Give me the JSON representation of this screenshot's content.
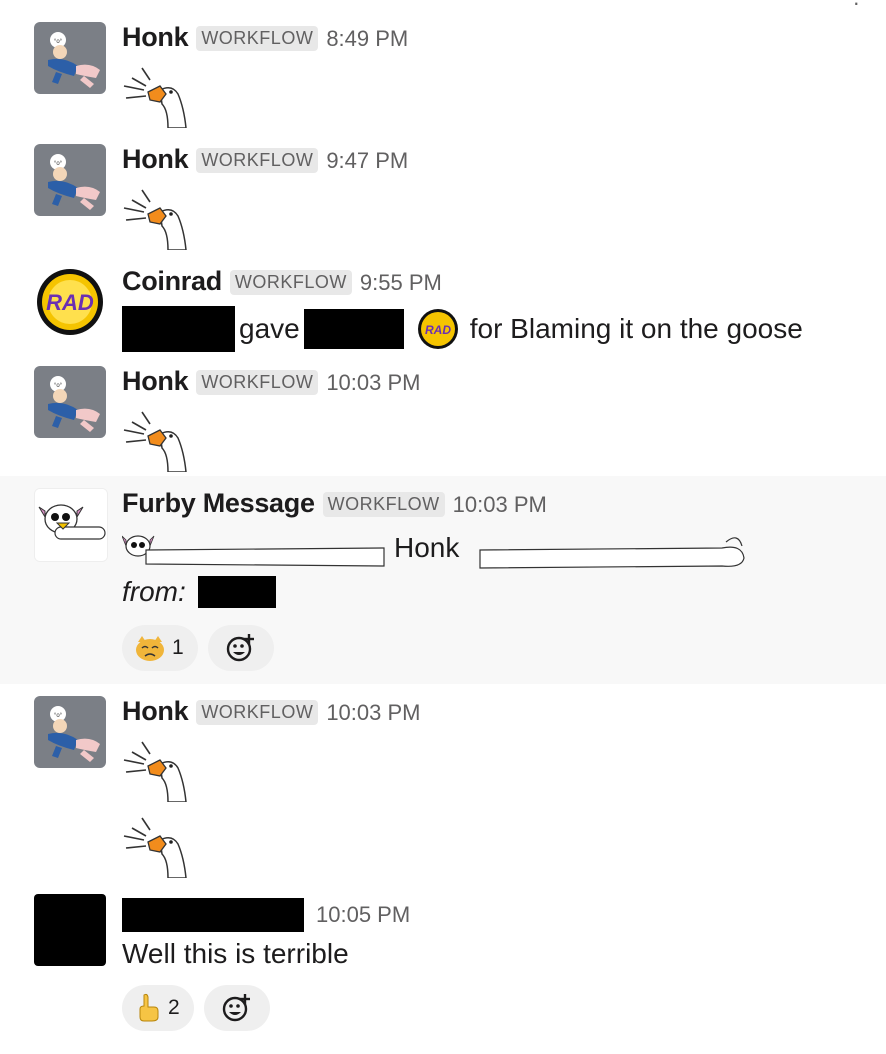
{
  "messages": [
    {
      "name": "Honk",
      "badge": "WORKFLOW",
      "time": "8:49 PM"
    },
    {
      "name": "Honk",
      "badge": "WORKFLOW",
      "time": "9:47 PM"
    },
    {
      "name": "Coinrad",
      "badge": "WORKFLOW",
      "time": "9:55 PM",
      "text_gave": "gave",
      "text_for": "for Blaming it on the goose"
    },
    {
      "name": "Honk",
      "badge": "WORKFLOW",
      "time": "10:03 PM"
    },
    {
      "name": "Furby Message",
      "badge": "WORKFLOW",
      "time": "10:03 PM",
      "honk": "Honk",
      "from_label": "from:",
      "reaction": {
        "emoji": "crying-cat-face",
        "count": "1"
      }
    },
    {
      "name": "Honk",
      "badge": "WORKFLOW",
      "time": "10:03 PM"
    },
    {
      "name": "",
      "time": "10:05 PM",
      "text": "Well this is terrible",
      "reaction": {
        "emoji": "point-up",
        "count": "2"
      }
    }
  ],
  "icons": {
    "goose": "honk-goose-icon",
    "add_reaction": "add-reaction-icon",
    "coin": "rad-coin-icon"
  },
  "colors": {
    "badge_bg": "#e8e8e8",
    "highlight_bg": "#f8f8f8",
    "coin_gold": "#f5c400",
    "coin_purple": "#6b2fb3"
  }
}
